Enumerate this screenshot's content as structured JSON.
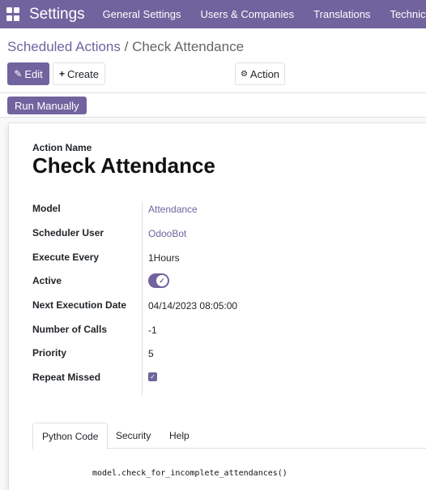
{
  "navbar": {
    "brand": "Settings",
    "menu": [
      "General Settings",
      "Users & Companies",
      "Translations",
      "Technical"
    ]
  },
  "breadcrumb": {
    "parent": "Scheduled Actions",
    "separator": " / ",
    "current": "Check Attendance"
  },
  "toolbar": {
    "edit_label": "Edit",
    "create_label": "Create",
    "action_label": "Action"
  },
  "statusbar": {
    "run_label": "Run Manually"
  },
  "form": {
    "name_label": "Action Name",
    "name_value": "Check Attendance",
    "fields": {
      "model": {
        "label": "Model",
        "value": "Attendance"
      },
      "user": {
        "label": "Scheduler User",
        "value": "OdooBot"
      },
      "interval": {
        "label": "Execute Every",
        "value": "1Hours"
      },
      "active": {
        "label": "Active",
        "checked": true
      },
      "nextcall": {
        "label": "Next Execution Date",
        "value": "04/14/2023 08:05:00"
      },
      "numcall": {
        "label": "Number of Calls",
        "value": "-1"
      },
      "priority": {
        "label": "Priority",
        "value": "5"
      },
      "doall": {
        "label": "Repeat Missed",
        "checked": true
      }
    }
  },
  "tabs": {
    "python": "Python Code",
    "security": "Security",
    "help": "Help"
  },
  "code": "model.check_for_incomplete_attendances()",
  "colors": {
    "accent": "#71639e"
  }
}
